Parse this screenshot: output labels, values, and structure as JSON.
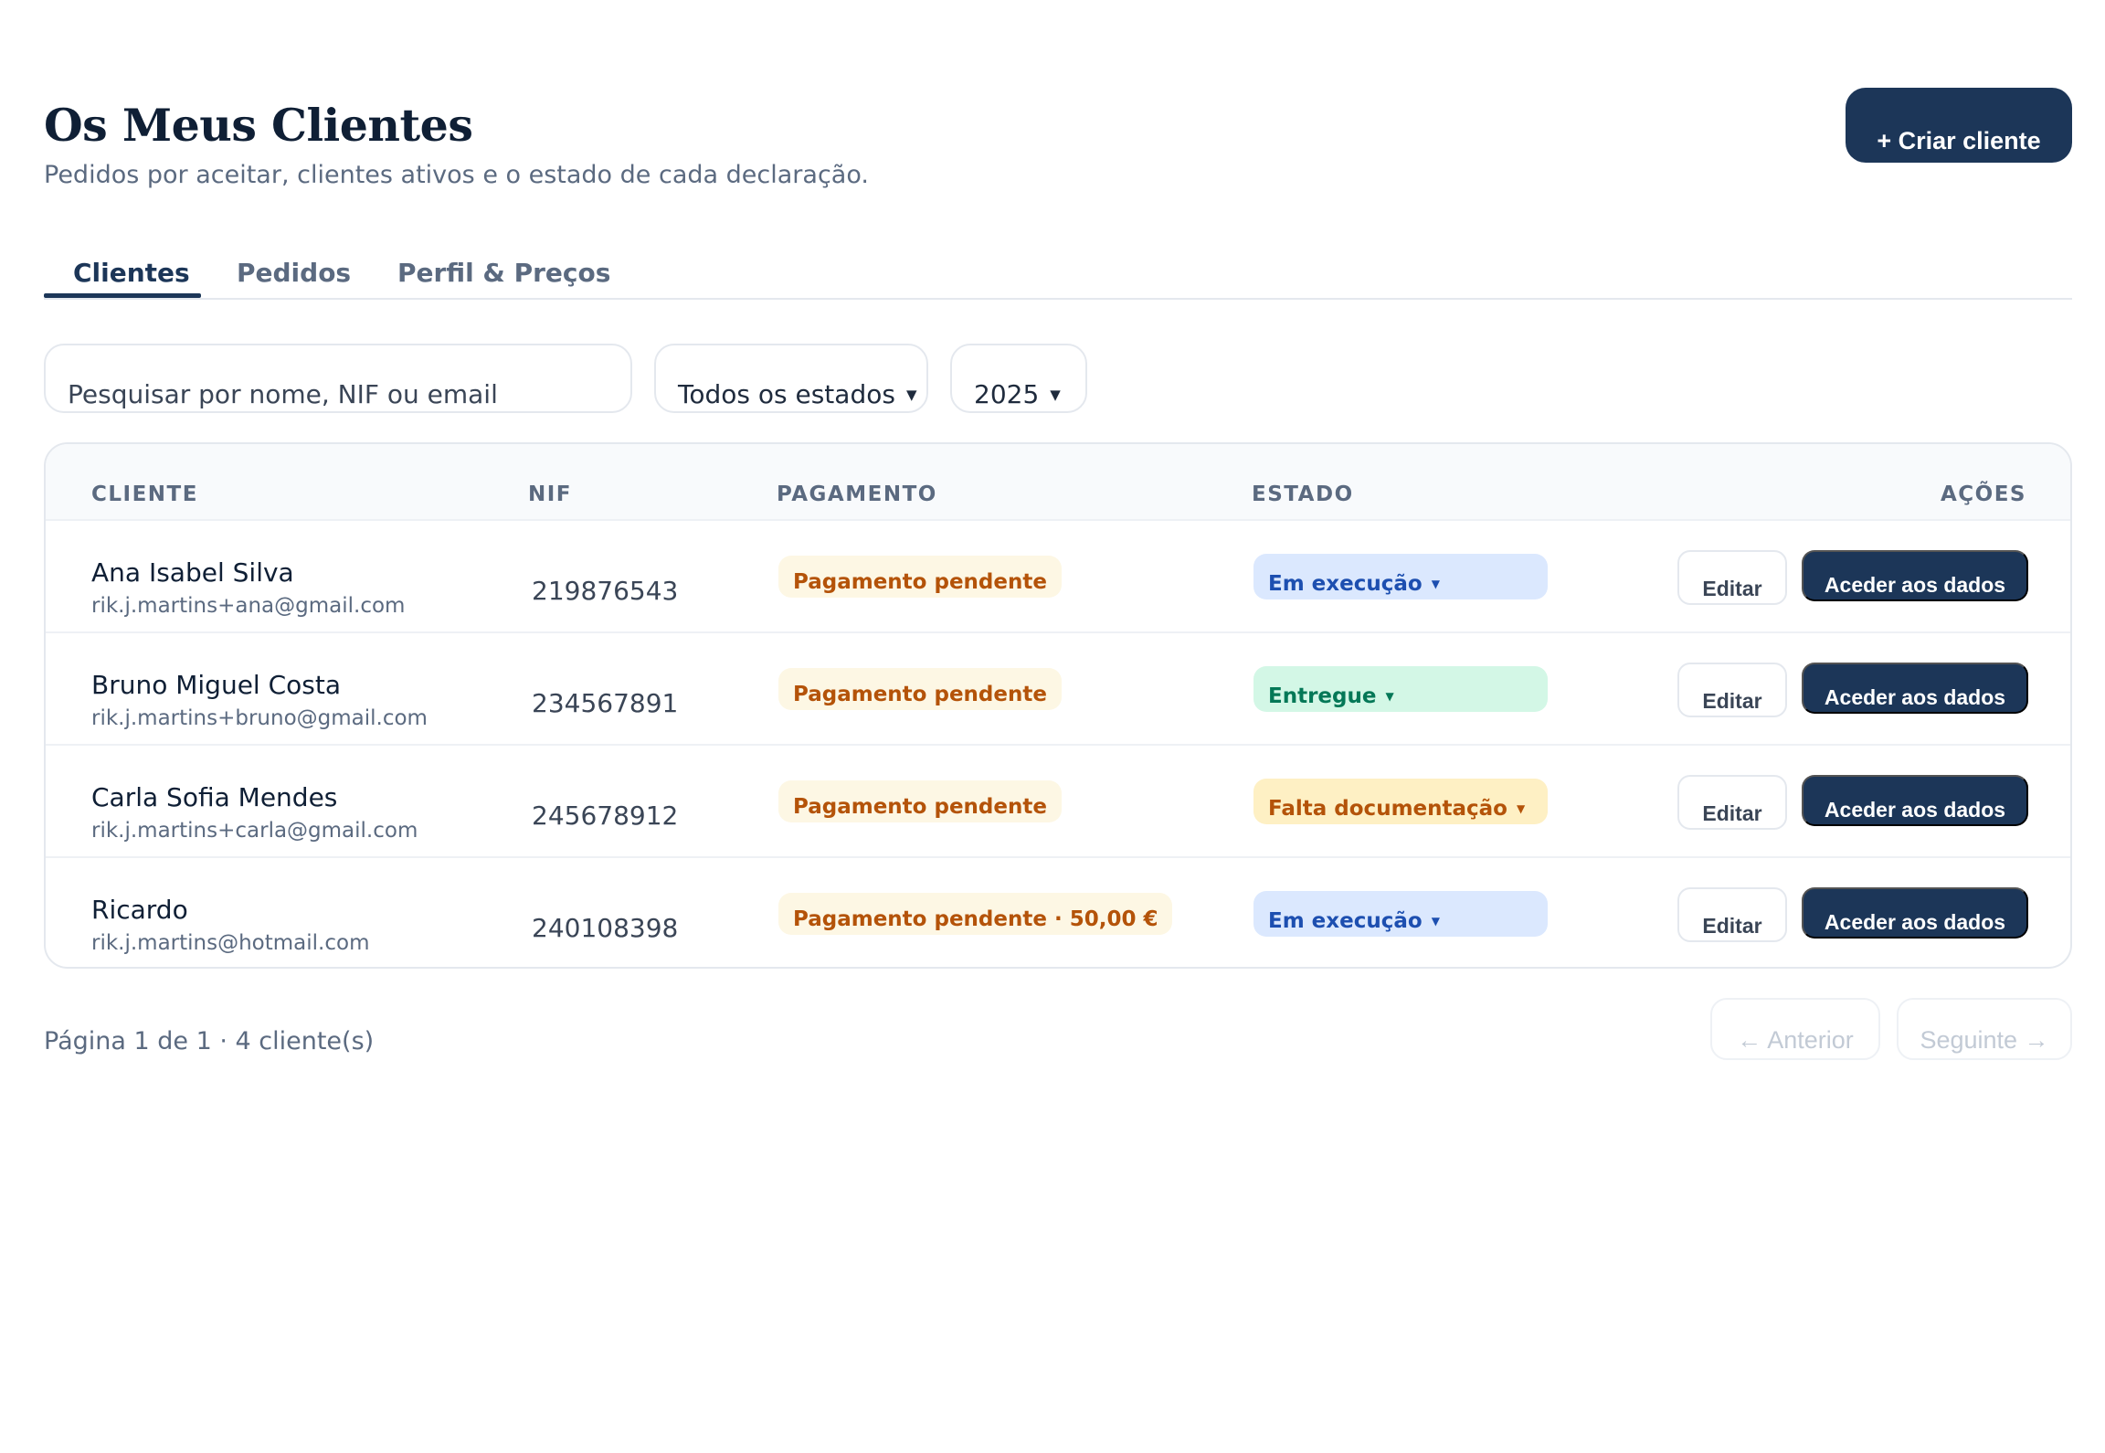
{
  "header": {
    "title": "Os Meus Clientes",
    "subtitle": "Pedidos por aceitar, clientes ativos e o estado de cada declaração.",
    "create_button": "+ Criar cliente"
  },
  "tabs": [
    {
      "label": "Clientes",
      "active": true
    },
    {
      "label": "Pedidos",
      "active": false
    },
    {
      "label": "Perfil & Preços",
      "active": false
    }
  ],
  "filters": {
    "search_placeholder": "Pesquisar por nome, NIF ou email",
    "status_value": "Todos os estados",
    "year_value": "2025"
  },
  "table": {
    "headers": {
      "client": "CLIENTE",
      "nif": "NIF",
      "payment": "PAGAMENTO",
      "state": "ESTADO",
      "actions": "AÇÕES"
    },
    "rows": [
      {
        "name": "Ana Isabel Silva",
        "email": "rik.j.martins+ana@gmail.com",
        "nif": "219876543",
        "payment": "Pagamento pendente",
        "state": "Em execução",
        "state_color": "#1d4fb0",
        "edit": "Editar",
        "access": "Aceder aos dados"
      },
      {
        "name": "Bruno Miguel Costa",
        "email": "rik.j.martins+bruno@gmail.com",
        "nif": "234567891",
        "payment": "Pagamento pendente",
        "state": "Entregue",
        "state_color": "#047857",
        "edit": "Editar",
        "access": "Aceder aos dados"
      },
      {
        "name": "Carla Sofia Mendes",
        "email": "rik.j.martins+carla@gmail.com",
        "nif": "245678912",
        "payment": "Pagamento pendente",
        "state": "Falta documentação",
        "state_color": "#b45309",
        "edit": "Editar",
        "access": "Aceder aos dados"
      },
      {
        "name": "Ricardo",
        "email": "rik.j.martins@hotmail.com",
        "nif": "240108398",
        "payment": "Pagamento pendente · 50,00 €",
        "state": "Em execução",
        "state_color": "#1d4fb0",
        "edit": "Editar",
        "access": "Aceder aos dados"
      }
    ]
  },
  "pagination": {
    "info": "Página 1 de 1 · 4 cliente(s)",
    "prev": "← Anterior",
    "next": "Seguinte →"
  },
  "icons": {
    "dropdown_caret": "▼"
  },
  "colors": {
    "primary": "#1c3658",
    "text_muted": "#5b6a80",
    "payment_pending_bg": "#fdf7e4",
    "payment_pending_text": "#b45309"
  }
}
